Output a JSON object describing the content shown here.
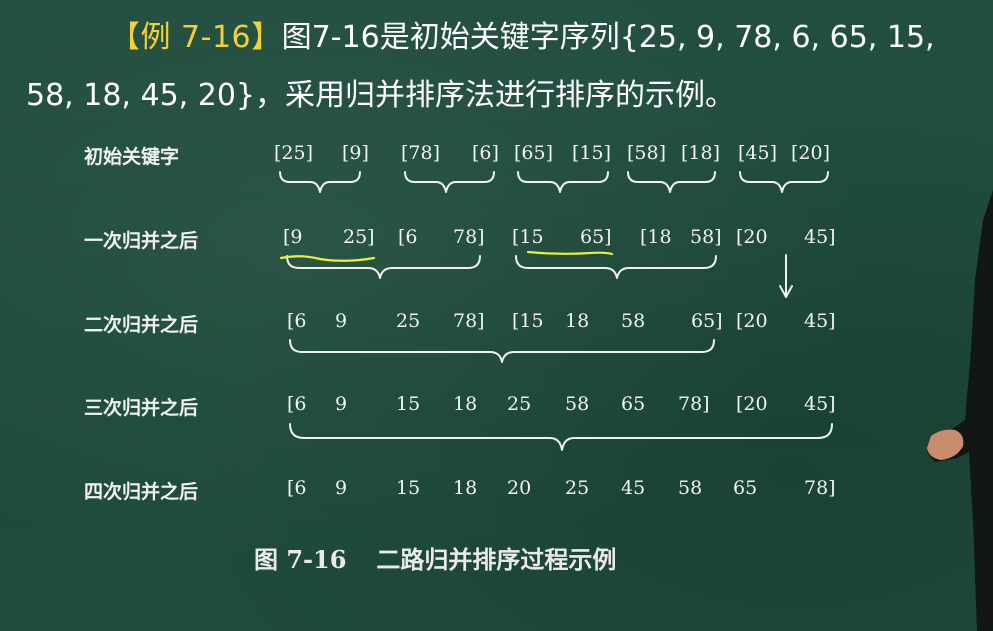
{
  "header": {
    "tag": "【例 7-16】",
    "line1_rest": "图7-16是初始关键字序列{25, 9, 78, 6, 65, 15,",
    "line2": "58, 18, 45, 20}，采用归并排序法进行排序的示例。"
  },
  "figure": {
    "rows": [
      {
        "label": "初始关键字",
        "tokens": [
          "[25]",
          "[9]",
          "[78]",
          "[6]",
          "[65]",
          "[15]",
          "[58]",
          "[18]",
          "[45]",
          "[20]"
        ]
      },
      {
        "label": "一次归并之后",
        "tokens": [
          "[9",
          "25]",
          "[6",
          "78]",
          "[15",
          "65]",
          "[18",
          "58]",
          "[20",
          "45]"
        ]
      },
      {
        "label": "二次归并之后",
        "tokens": [
          "[6",
          "9",
          "25",
          "78]",
          "[15",
          "18",
          "58",
          "65]",
          "[20",
          "45]"
        ]
      },
      {
        "label": "三次归并之后",
        "tokens": [
          "[6",
          "9",
          "15",
          "18",
          "25",
          "58",
          "65",
          "78]",
          "[20",
          "45]"
        ]
      },
      {
        "label": "四次归并之后",
        "tokens": [
          "[6",
          "9",
          "15",
          "18",
          "20",
          "25",
          "45",
          "58",
          "65",
          "78]"
        ]
      }
    ],
    "caption_number": "图 7-16",
    "caption_title": "二路归并排序过程示例"
  },
  "colors": {
    "board": "#1f4d3b",
    "tag_yellow": "#f2d03b",
    "annotation_yellow": "#e8f03a"
  }
}
